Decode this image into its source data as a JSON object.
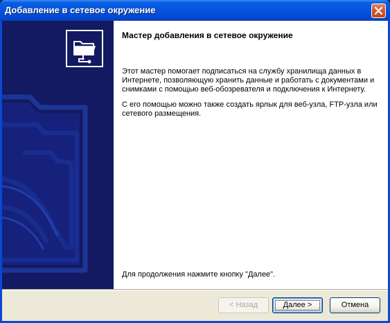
{
  "window": {
    "title": "Добавление в сетевое окружение"
  },
  "wizard": {
    "heading": "Мастер добавления в сетевое окружение",
    "paragraph_1": "Этот мастер помогает подписаться на службу хранилища данных в Интернете, позволяющую хранить данные и работать с документами и снимками с помощью веб-обозревателя и подключения к Интернету.",
    "paragraph_2": "С его помощью можно также создать ярлык для веб-узла, FTP-узла или сетевого размещения.",
    "continue_hint": "Для продолжения нажмите кнопку \"Далее\"."
  },
  "buttons": {
    "back_label": "< Назад",
    "next_label": "Далее >",
    "cancel_label": "Отмена",
    "back_enabled": false
  },
  "icons": {
    "close": "close-icon",
    "hero": "network-folder-icon",
    "banner": "folders-watermark"
  },
  "colors": {
    "title_bar": "#0554e0",
    "banner": "#131a61",
    "banner_art": "#1f3aa0",
    "close_button": "#d35a2f",
    "dialog_face": "#ece9d8"
  }
}
